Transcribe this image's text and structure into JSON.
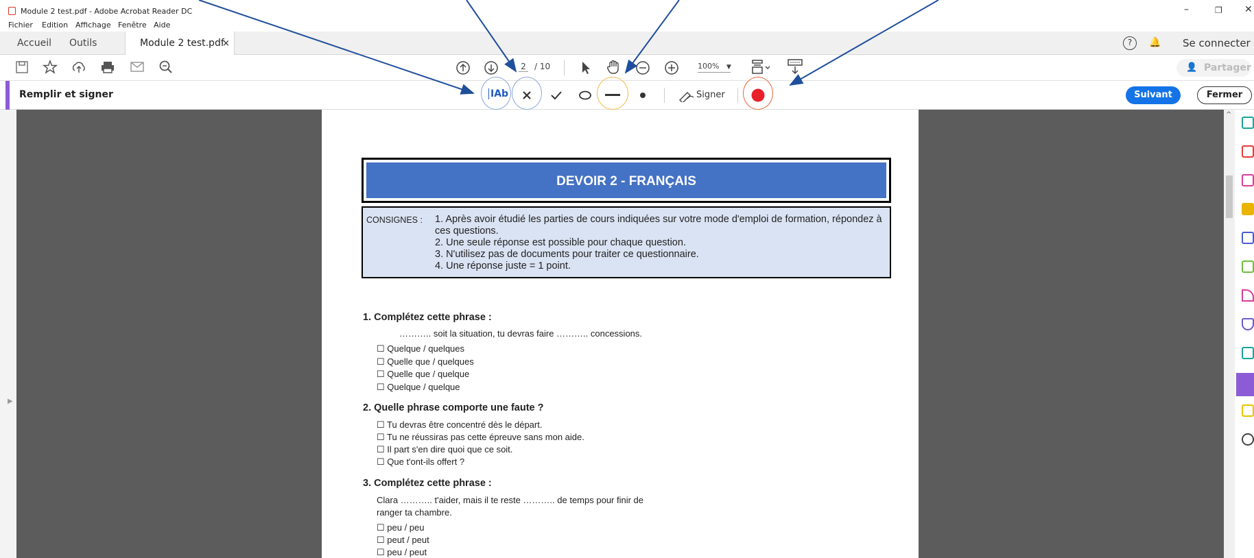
{
  "window": {
    "title": "Module 2 test.pdf - Adobe Acrobat Reader DC",
    "minimize": "–",
    "restore": "❐",
    "close": "✕"
  },
  "menu": [
    "Fichier",
    "Edition",
    "Affichage",
    "Fenêtre",
    "Aide"
  ],
  "tabs": {
    "home": "Accueil",
    "tools": "Outils",
    "document": "Module 2 test.pdf",
    "close": "×",
    "help": "?",
    "bell": "🔔",
    "signin": "Se connecter"
  },
  "toolbar": {
    "page_current": "2",
    "page_total": "/ 10",
    "zoom": "100%",
    "share": "Partager"
  },
  "fill_sign": {
    "label": "Remplir et signer",
    "text_tool": "IAb",
    "sign": "Signer",
    "next": "Suivant",
    "close": "Fermer"
  },
  "document": {
    "title": "DEVOIR 2 - FRANÇAIS",
    "consignes_label": "CONSIGNES :",
    "consignes": [
      "1. Après avoir étudié les parties de cours indiquées sur votre mode d'emploi de formation, répondez à ces questions.",
      "2. Une seule réponse est possible pour chaque question.",
      "3. N'utilisez pas de documents pour traiter ce questionnaire.",
      "4. Une réponse juste = 1 point."
    ],
    "q1": {
      "title": "1. Complétez cette phrase :",
      "prompt": "……….. soit la situation, tu devras faire ……….. concessions.",
      "options": [
        "☐ Quelque / quelques",
        "☐ Quelle que / quelques",
        "☐ Quelle que / quelque",
        "☐ Quelque / quelque"
      ]
    },
    "q2": {
      "title": "2. Quelle phrase comporte une faute ?",
      "options": [
        "☐ Tu devras être concentré dès le départ.",
        "☐ Tu ne réussiras pas cette épreuve sans mon aide.",
        "☐ Il part s'en dire quoi que ce soit.",
        "☐ Que t'ont-ils offert ?"
      ]
    },
    "q3": {
      "title": "3. Complétez cette phrase :",
      "prompt1": "Clara ……….. t'aider, mais il te reste ……….. de temps pour finir de",
      "prompt2": "ranger ta chambre.",
      "options": [
        "☐ peu / peu",
        "☐ peut / peut",
        "☐ peu / peut"
      ]
    }
  },
  "colors": {
    "accent": "#8b5cd6",
    "blue_button": "#1473e6",
    "header_blue": "#4472c4",
    "consignes_bg": "#dae3f3",
    "red_dot": "#e8202a",
    "ring_blue": "#8aa6e0",
    "ring_orange": "#f5b94a",
    "ring_red": "#e8683a"
  }
}
